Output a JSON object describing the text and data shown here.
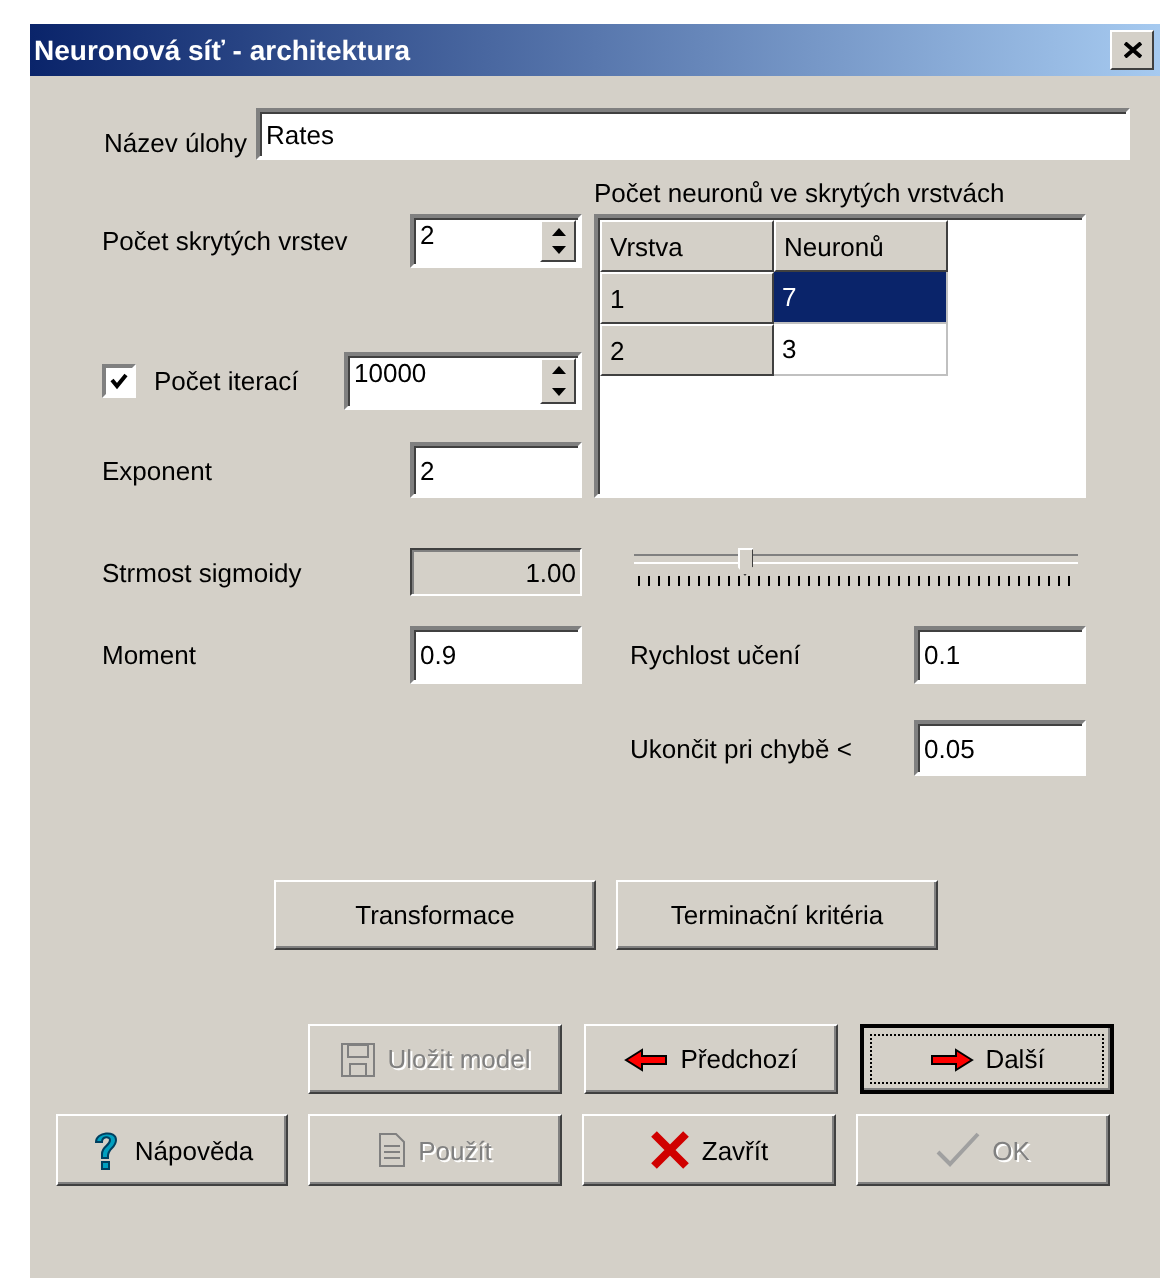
{
  "window": {
    "title": "Neuronová síť - architektura"
  },
  "task_name": {
    "label": "Název úlohy",
    "value": "Rates"
  },
  "hidden_layers": {
    "label": "Počet skrytých vrstev",
    "value": "2"
  },
  "iterations": {
    "label": "Počet iterací",
    "checked": true,
    "value": "10000"
  },
  "exponent": {
    "label": "Exponent",
    "value": "2"
  },
  "neurons_table": {
    "title": "Počet neuronů ve skrytých vrstvách",
    "columns": [
      "Vrstva",
      "Neuronů"
    ],
    "rows": [
      {
        "layer": "1",
        "neurons": "7",
        "selected": true
      },
      {
        "layer": "2",
        "neurons": "3",
        "selected": false
      }
    ]
  },
  "steepness": {
    "label": "Strmost sigmoidy",
    "value": "1.00",
    "level": 0.25
  },
  "moment": {
    "label": "Moment",
    "value": "0.9"
  },
  "learning_rate": {
    "label": "Rychlost učení",
    "value": "0.1"
  },
  "stop_error": {
    "label": "Ukončit pri chybě <",
    "value": "0.05"
  },
  "option_buttons": [
    {
      "label": "Transformace",
      "disabled": false,
      "default": false
    },
    {
      "label": "Terminační kritéria",
      "disabled": false,
      "default": false
    }
  ],
  "nav_buttons": [
    {
      "label": "Uložit model",
      "kind": "save",
      "disabled": true,
      "default": false
    },
    {
      "label": "Předchozí",
      "kind": "previous",
      "disabled": false,
      "default": false
    },
    {
      "label": "Další",
      "kind": "next",
      "disabled": false,
      "default": true
    }
  ],
  "footer_buttons": [
    {
      "label": "Nápověda",
      "kind": "help",
      "disabled": false,
      "default": false
    },
    {
      "label": "Použít",
      "kind": "apply",
      "disabled": true,
      "default": false
    },
    {
      "label": "Zavřít",
      "kind": "close",
      "disabled": false,
      "default": false
    },
    {
      "label": "OK",
      "kind": "ok",
      "disabled": true,
      "default": false
    }
  ]
}
